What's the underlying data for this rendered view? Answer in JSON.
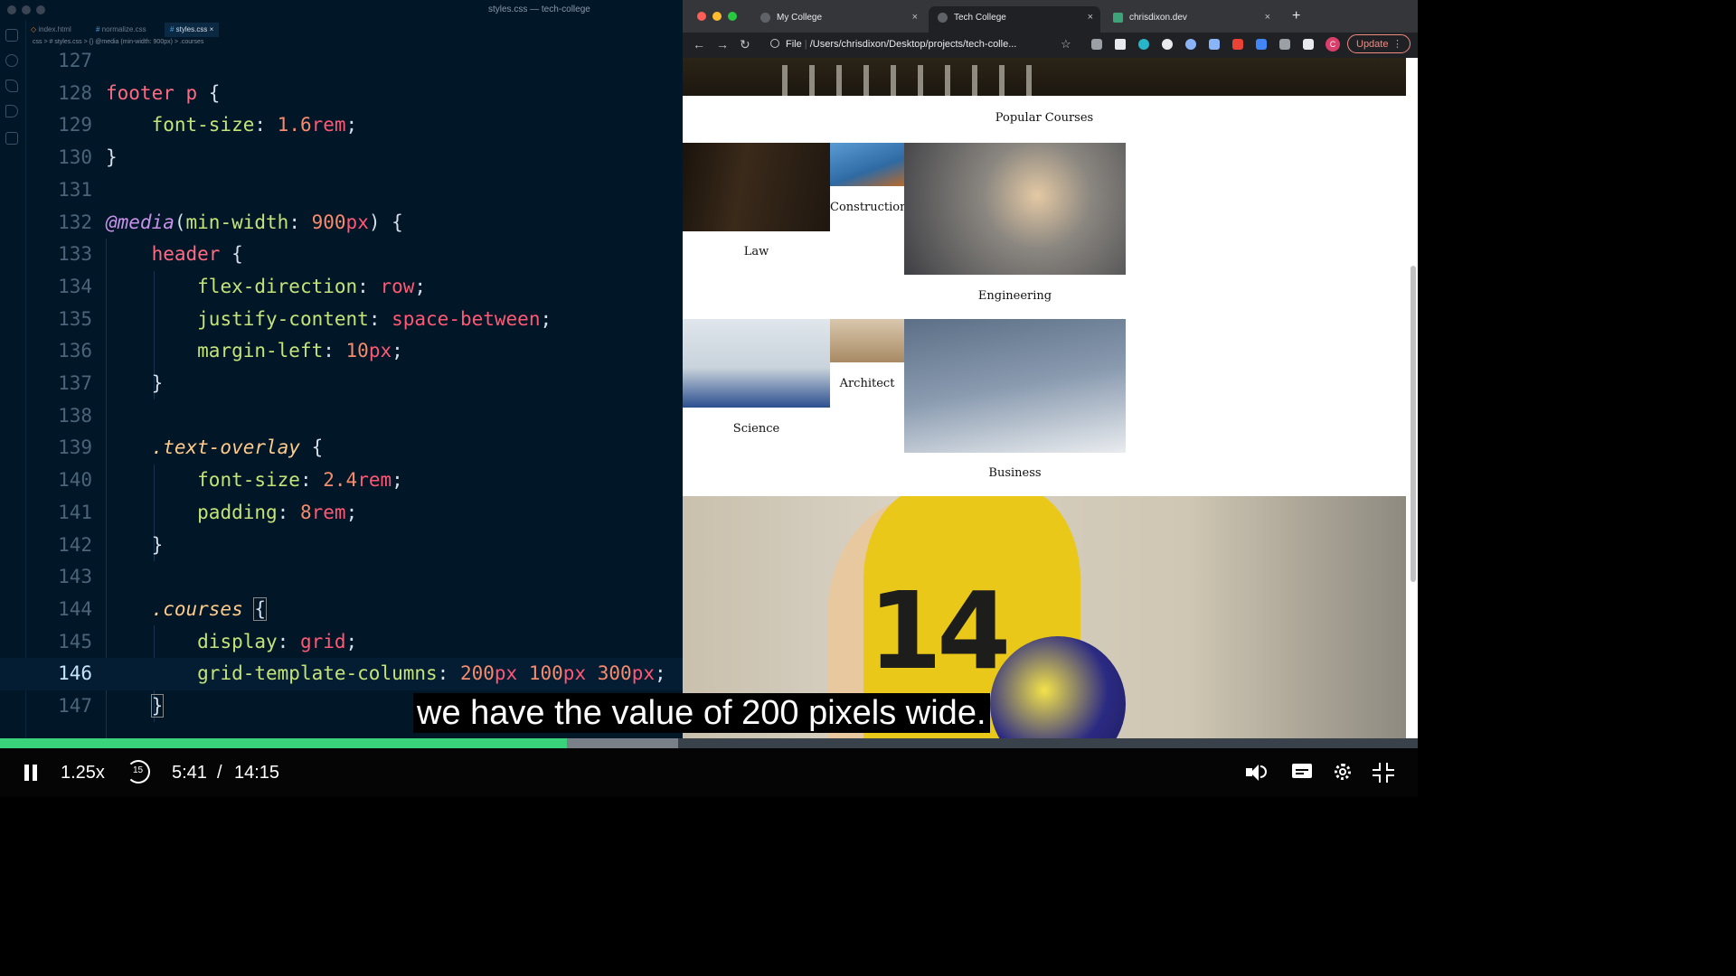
{
  "editor": {
    "window_title": "styles.css — tech-college",
    "tabs": [
      {
        "label": "index.html",
        "active": false
      },
      {
        "label": "normalize.css",
        "active": false
      },
      {
        "label": "styles.css",
        "active": true
      }
    ],
    "tab_close": "×",
    "breadcrumb": "css > # styles.css > {} @media (min-width: 900px) > .courses",
    "current_line": "146",
    "lines": [
      {
        "n": "127",
        "tokens": []
      },
      {
        "n": "128",
        "tokens": [
          [
            "sel",
            "footer p"
          ],
          [
            "pun",
            " {"
          ]
        ]
      },
      {
        "n": "129",
        "tokens": [
          [
            "pun",
            "    "
          ],
          [
            "prop",
            "font-size"
          ],
          [
            "pun",
            ": "
          ],
          [
            "num",
            "1.6"
          ],
          [
            "val",
            "rem"
          ],
          [
            "pun",
            ";"
          ]
        ]
      },
      {
        "n": "130",
        "tokens": [
          [
            "pun",
            "}"
          ]
        ]
      },
      {
        "n": "131",
        "tokens": []
      },
      {
        "n": "132",
        "tokens": [
          [
            "at",
            "@media"
          ],
          [
            "pun",
            "("
          ],
          [
            "prop",
            "min-width"
          ],
          [
            "pun",
            ": "
          ],
          [
            "num",
            "900"
          ],
          [
            "val",
            "px"
          ],
          [
            "pun",
            ") {"
          ]
        ]
      },
      {
        "n": "133",
        "tokens": [
          [
            "pun",
            "    "
          ],
          [
            "sel",
            "header"
          ],
          [
            "pun",
            " {"
          ]
        ]
      },
      {
        "n": "134",
        "tokens": [
          [
            "pun",
            "        "
          ],
          [
            "prop",
            "flex-direction"
          ],
          [
            "pun",
            ": "
          ],
          [
            "val",
            "row"
          ],
          [
            "pun",
            ";"
          ]
        ]
      },
      {
        "n": "135",
        "tokens": [
          [
            "pun",
            "        "
          ],
          [
            "prop",
            "justify-content"
          ],
          [
            "pun",
            ": "
          ],
          [
            "val",
            "space-between"
          ],
          [
            "pun",
            ";"
          ]
        ]
      },
      {
        "n": "136",
        "tokens": [
          [
            "pun",
            "        "
          ],
          [
            "prop",
            "margin-left"
          ],
          [
            "pun",
            ": "
          ],
          [
            "num",
            "10"
          ],
          [
            "val",
            "px"
          ],
          [
            "pun",
            ";"
          ]
        ]
      },
      {
        "n": "137",
        "tokens": [
          [
            "pun",
            "    }"
          ]
        ]
      },
      {
        "n": "138",
        "tokens": []
      },
      {
        "n": "139",
        "tokens": [
          [
            "pun",
            "    "
          ],
          [
            "cls",
            ".text-overlay"
          ],
          [
            "pun",
            " {"
          ]
        ]
      },
      {
        "n": "140",
        "tokens": [
          [
            "pun",
            "        "
          ],
          [
            "prop",
            "font-size"
          ],
          [
            "pun",
            ": "
          ],
          [
            "num",
            "2.4"
          ],
          [
            "val",
            "rem"
          ],
          [
            "pun",
            ";"
          ]
        ]
      },
      {
        "n": "141",
        "tokens": [
          [
            "pun",
            "        "
          ],
          [
            "prop",
            "padding"
          ],
          [
            "pun",
            ": "
          ],
          [
            "num",
            "8"
          ],
          [
            "val",
            "rem"
          ],
          [
            "pun",
            ";"
          ]
        ]
      },
      {
        "n": "142",
        "tokens": [
          [
            "pun",
            "    }"
          ]
        ]
      },
      {
        "n": "143",
        "tokens": []
      },
      {
        "n": "144",
        "tokens": [
          [
            "pun",
            "    "
          ],
          [
            "cls",
            ".courses"
          ],
          [
            "pun",
            " "
          ],
          [
            "bracket",
            "{"
          ]
        ]
      },
      {
        "n": "145",
        "tokens": [
          [
            "pun",
            "        "
          ],
          [
            "prop",
            "display"
          ],
          [
            "pun",
            ": "
          ],
          [
            "val",
            "grid"
          ],
          [
            "pun",
            ";"
          ]
        ]
      },
      {
        "n": "146",
        "tokens": [
          [
            "pun",
            "        "
          ],
          [
            "prop",
            "grid-template-columns"
          ],
          [
            "pun",
            ": "
          ],
          [
            "num",
            "200"
          ],
          [
            "val",
            "px"
          ],
          [
            "pun",
            " "
          ],
          [
            "num",
            "100"
          ],
          [
            "val",
            "px"
          ],
          [
            "pun",
            " "
          ],
          [
            "num",
            "300"
          ],
          [
            "val",
            "px"
          ],
          [
            "pun",
            ";"
          ]
        ]
      },
      {
        "n": "147",
        "tokens": [
          [
            "pun",
            "    "
          ],
          [
            "bracket",
            "}"
          ]
        ]
      }
    ]
  },
  "browser": {
    "tabs": [
      {
        "label": "My College",
        "active": false
      },
      {
        "label": "Tech College",
        "active": true
      },
      {
        "label": "chrisdixon.dev",
        "active": false
      }
    ],
    "tab_close": "×",
    "new_tab": "+",
    "nav": {
      "back": "←",
      "forward": "→",
      "reload": "↻"
    },
    "url_scheme": "File",
    "url": "/Users/chrisdixon/Desktop/projects/tech-colle...",
    "star": "☆",
    "avatar_letter": "C",
    "update_label": "Update",
    "menu": "⋮"
  },
  "page": {
    "section_title": "Popular Courses",
    "courses": [
      {
        "name": "Law",
        "color": "#2a2018"
      },
      {
        "name": "Construction",
        "color": "#3f7fb6"
      },
      {
        "name": "Engineering",
        "color": "#6b6560"
      },
      {
        "name": "Science",
        "color": "#b9c7d3"
      },
      {
        "name": "Architect",
        "color": "#9a8466"
      },
      {
        "name": "Business",
        "color": "#5b6a7d"
      }
    ],
    "jersey_number": "14"
  },
  "player": {
    "caption": "we have the value of 200 pixels wide.",
    "speed": "1.25x",
    "skip_back": "15",
    "current_time": "5:41",
    "separator": "/",
    "duration": "14:15",
    "played_fraction": 0.4,
    "buffered_fraction": 0.478,
    "colors": {
      "played": "#39d37b",
      "buffered": "#7a8087",
      "track": "#39424a"
    }
  }
}
